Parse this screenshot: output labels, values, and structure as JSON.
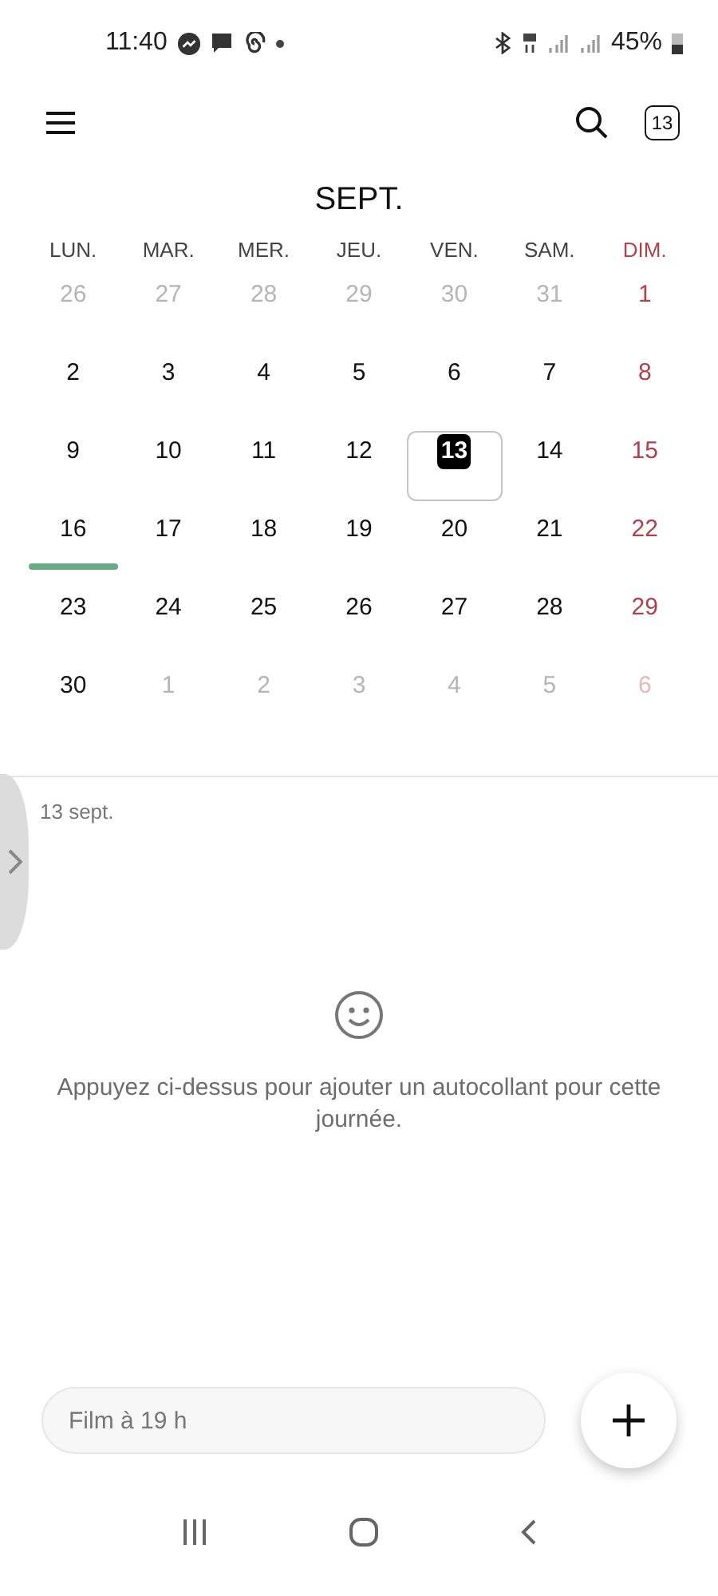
{
  "status_bar": {
    "time": "11:40",
    "battery": "45%"
  },
  "toolbar": {
    "today_badge": "13"
  },
  "calendar": {
    "month_title": "SEPT.",
    "weekdays": [
      {
        "label": "LUN.",
        "kind": "weekday"
      },
      {
        "label": "MAR.",
        "kind": "weekday"
      },
      {
        "label": "MER.",
        "kind": "weekday"
      },
      {
        "label": "JEU.",
        "kind": "weekday"
      },
      {
        "label": "VEN.",
        "kind": "weekday"
      },
      {
        "label": "SAM.",
        "kind": "weekday"
      },
      {
        "label": "DIM.",
        "kind": "sunday"
      }
    ],
    "weeks": [
      [
        {
          "day": "26",
          "in_month": false,
          "kind": "weekday"
        },
        {
          "day": "27",
          "in_month": false,
          "kind": "weekday"
        },
        {
          "day": "28",
          "in_month": false,
          "kind": "weekday"
        },
        {
          "day": "29",
          "in_month": false,
          "kind": "weekday"
        },
        {
          "day": "30",
          "in_month": false,
          "kind": "weekday"
        },
        {
          "day": "31",
          "in_month": false,
          "kind": "weekday"
        },
        {
          "day": "1",
          "in_month": true,
          "kind": "sunday"
        }
      ],
      [
        {
          "day": "2",
          "in_month": true,
          "kind": "weekday"
        },
        {
          "day": "3",
          "in_month": true,
          "kind": "weekday"
        },
        {
          "day": "4",
          "in_month": true,
          "kind": "weekday"
        },
        {
          "day": "5",
          "in_month": true,
          "kind": "weekday"
        },
        {
          "day": "6",
          "in_month": true,
          "kind": "weekday"
        },
        {
          "day": "7",
          "in_month": true,
          "kind": "weekday"
        },
        {
          "day": "8",
          "in_month": true,
          "kind": "sunday"
        }
      ],
      [
        {
          "day": "9",
          "in_month": true,
          "kind": "weekday"
        },
        {
          "day": "10",
          "in_month": true,
          "kind": "weekday"
        },
        {
          "day": "11",
          "in_month": true,
          "kind": "weekday"
        },
        {
          "day": "12",
          "in_month": true,
          "kind": "weekday"
        },
        {
          "day": "13",
          "in_month": true,
          "kind": "weekday",
          "today": true,
          "selected": true
        },
        {
          "day": "14",
          "in_month": true,
          "kind": "weekday"
        },
        {
          "day": "15",
          "in_month": true,
          "kind": "sunday"
        }
      ],
      [
        {
          "day": "16",
          "in_month": true,
          "kind": "weekday",
          "color": "#6aaa84"
        },
        {
          "day": "17",
          "in_month": true,
          "kind": "weekday"
        },
        {
          "day": "18",
          "in_month": true,
          "kind": "weekday"
        },
        {
          "day": "19",
          "in_month": true,
          "kind": "weekday"
        },
        {
          "day": "20",
          "in_month": true,
          "kind": "weekday"
        },
        {
          "day": "21",
          "in_month": true,
          "kind": "weekday"
        },
        {
          "day": "22",
          "in_month": true,
          "kind": "sunday"
        }
      ],
      [
        {
          "day": "23",
          "in_month": true,
          "kind": "weekday"
        },
        {
          "day": "24",
          "in_month": true,
          "kind": "weekday"
        },
        {
          "day": "25",
          "in_month": true,
          "kind": "weekday"
        },
        {
          "day": "26",
          "in_month": true,
          "kind": "weekday"
        },
        {
          "day": "27",
          "in_month": true,
          "kind": "weekday"
        },
        {
          "day": "28",
          "in_month": true,
          "kind": "weekday"
        },
        {
          "day": "29",
          "in_month": true,
          "kind": "sunday"
        }
      ],
      [
        {
          "day": "30",
          "in_month": true,
          "kind": "weekday"
        },
        {
          "day": "1",
          "in_month": false,
          "kind": "weekday"
        },
        {
          "day": "2",
          "in_month": false,
          "kind": "weekday"
        },
        {
          "day": "3",
          "in_month": false,
          "kind": "weekday"
        },
        {
          "day": "4",
          "in_month": false,
          "kind": "weekday"
        },
        {
          "day": "5",
          "in_month": false,
          "kind": "weekday"
        },
        {
          "day": "6",
          "in_month": false,
          "kind": "sunday"
        }
      ]
    ]
  },
  "day_panel": {
    "date": "13 sept.",
    "empty_message": "Appuyez ci-dessus pour ajouter un autocollant pour cette journée."
  },
  "quick_add": {
    "placeholder": "Film à 19 h"
  }
}
